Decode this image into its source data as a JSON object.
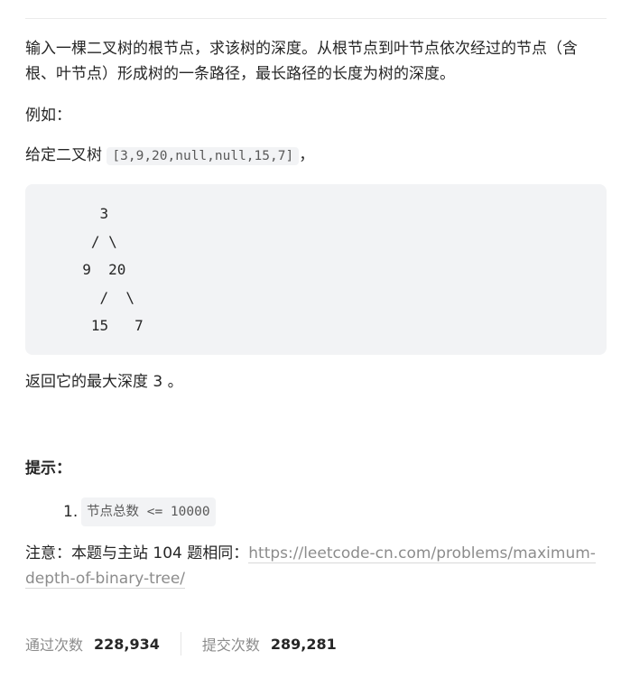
{
  "problem": {
    "intro": "输入一棵二叉树的根节点，求该树的深度。从根节点到叶节点依次经过的节点（含根、叶节点）形成树的一条路径，最长路径的长度为树的深度。",
    "example_label": "例如：",
    "given_prefix": "给定二叉树",
    "given_array": "[3,9,20,null,null,15,7]",
    "given_suffix": "，",
    "tree_ascii": "    3\n   / \\\n  9  20\n    /  \\\n   15   7",
    "return_text": "返回它的最大深度 3 。"
  },
  "hints": {
    "title": "提示：",
    "items": [
      {
        "number": "1.",
        "code": "节点总数 <= 10000"
      }
    ]
  },
  "note": {
    "prefix": "注意：本题与主站 104 题相同：",
    "link_text": "https://leetcode-cn.com/problems/maximum-depth-of-binary-tree/"
  },
  "stats": {
    "accepted_label": "通过次数",
    "accepted_value": "228,934",
    "submitted_label": "提交次数",
    "submitted_value": "289,281"
  },
  "colors": {
    "code_background": "#f2f3f5",
    "muted_text": "#8c8c8c",
    "body_text": "#262626"
  }
}
